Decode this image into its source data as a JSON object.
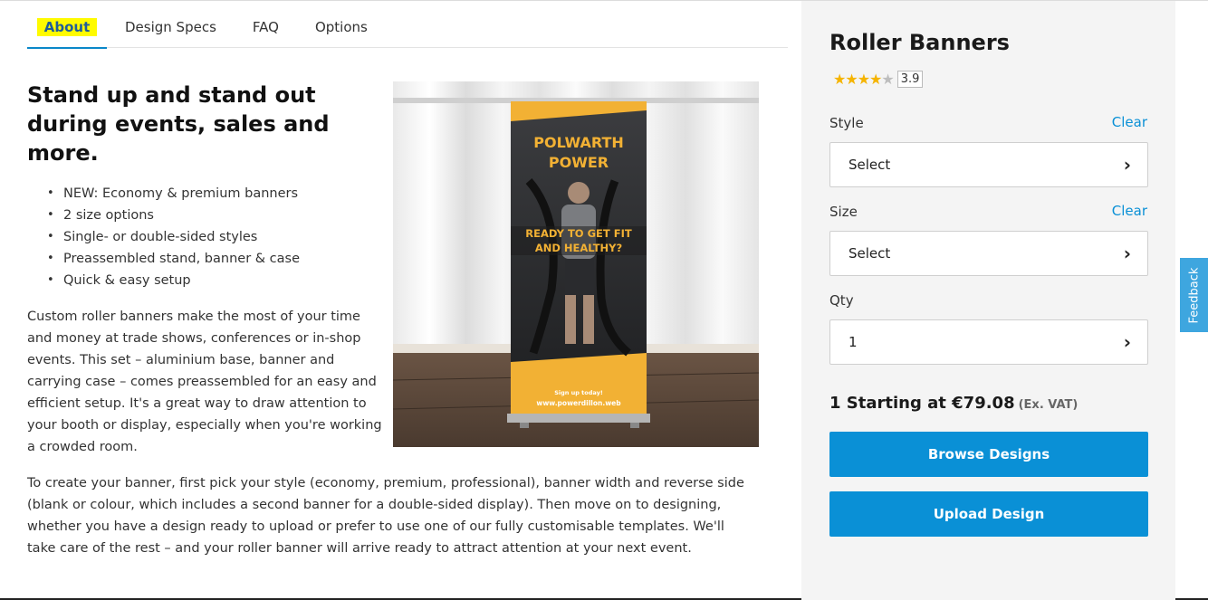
{
  "tabs": [
    "About",
    "Design Specs",
    "FAQ",
    "Options"
  ],
  "headline": "Stand up and stand out during events, sales and more.",
  "bullets": [
    "NEW: Economy & premium banners",
    "2 size options",
    "Single- or double-sided styles",
    "Preassembled stand, banner & case",
    "Quick & easy setup"
  ],
  "paragraphs": [
    "Custom roller banners make the most of your time and money at trade shows, conferences or in-shop events. This set – aluminium base, banner and carrying case – comes preassembled for an easy and efficient setup. It's a great way to draw attention to your booth or display, especially when you're working a crowded room.",
    "To create your banner, first pick your style (economy, premium, professional), banner width and reverse side (blank or colour, which includes a second banner for a double-sided display). Then move on to designing, whether you have a design ready to upload or prefer to use one of our fully customisable templates. We'll take care of the rest – and your roller banner will arrive ready to attract attention at your next event."
  ],
  "photo": {
    "banner_title_line1": "POLWARTH",
    "banner_title_line2": "POWER",
    "banner_tagline_line1": "READY TO GET FIT",
    "banner_tagline_line2": "AND HEALTHY?",
    "banner_footer_line1": "Sign up today!",
    "banner_footer_line2": "www.powerdillon.web"
  },
  "panel": {
    "title": "Roller Banners",
    "rating": {
      "stars_filled": 4,
      "stars_total": 5,
      "value": "3.9"
    },
    "style": {
      "label": "Style",
      "clear": "Clear",
      "value": "Select"
    },
    "size": {
      "label": "Size",
      "clear": "Clear",
      "value": "Select"
    },
    "qty": {
      "label": "Qty",
      "value": "1"
    },
    "price": {
      "text": "1 Starting at €79.08",
      "vat": "(Ex. VAT)"
    },
    "browse_label": "Browse Designs",
    "upload_label": "Upload Design"
  },
  "feedback_label": "Feedback",
  "colors": {
    "accent": "#0a90d6",
    "tab_highlight": "#fffb00",
    "star": "#f5b400",
    "banner_yellow": "#f2b134"
  },
  "icons": {
    "chevron": "chevron-right-icon",
    "star": "star-icon"
  }
}
